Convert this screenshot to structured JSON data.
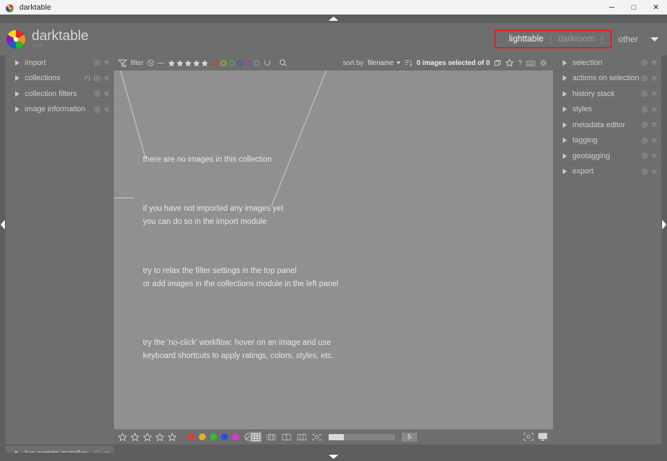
{
  "window": {
    "title": "darktable",
    "icon": "darktable-logo-icon",
    "buttons": {
      "minimize": "─",
      "maximize": "□",
      "close": "✕"
    }
  },
  "banner": {
    "logo_icon": "darktable-aperture-logo-icon",
    "brand": "darktable",
    "version": "4.0.0",
    "views": {
      "highlight_color": "#e02020",
      "items": [
        {
          "label": "lighttable",
          "active": true
        },
        {
          "label": "darkroom",
          "active": false
        },
        {
          "label": "other",
          "active": false
        }
      ],
      "separator": "|",
      "dropdown_icon": "chevron-down-icon"
    }
  },
  "left_panel": {
    "modules": [
      {
        "label": "import",
        "extra_icon": null
      },
      {
        "label": "collections",
        "extra_icon": "sort-icon"
      },
      {
        "label": "collection filters",
        "extra_icon": null
      },
      {
        "label": "image information",
        "extra_icon": null
      }
    ],
    "footer": {
      "label": "lua scripts installer"
    },
    "row_icons": [
      "reset-icon",
      "presets-icon"
    ]
  },
  "right_panel": {
    "modules": [
      {
        "label": "selection"
      },
      {
        "label": "actions on selection"
      },
      {
        "label": "history stack"
      },
      {
        "label": "styles"
      },
      {
        "label": "metadata editor"
      },
      {
        "label": "tagging"
      },
      {
        "label": "geotagging"
      },
      {
        "label": "export"
      }
    ],
    "row_icons": [
      "reset-icon",
      "presets-icon"
    ]
  },
  "filterbar": {
    "filter_icon": "filter-funnel-icon",
    "filter_label": "filter",
    "rating_reject_icon": "reject-circle-icon",
    "rating_dash": "—",
    "stars": 5,
    "color_labels": [
      "#b04a4a",
      "#b09a3a",
      "#4aa04a",
      "#4a5ab0",
      "#9a4aa8",
      "#8a8a8a"
    ],
    "grouping_icon": "grouping-icon",
    "search_icon": "search-icon",
    "sort_label": "sort by",
    "sort_value": "filename",
    "sort_direction_icon": "sort-ascending-icon",
    "selection_text": "0 images selected of 0",
    "right_icons": [
      "copy-icon",
      "star-icon",
      "help-icon",
      "shortcuts-icon",
      "preferences-gear-icon"
    ]
  },
  "canvas": {
    "messages": [
      "there are no images in this collection",
      "if you have not imported any images yet\nyou can do so in the import module",
      "try to relax the filter settings in the top panel\nor add images in the collections module in the left panel",
      "try the 'no-click' workflow: hover on an image and use\nkeyboard shortcuts to apply ratings, colors, styles, etc."
    ]
  },
  "bottombar": {
    "stars": 5,
    "color_dots": [
      "#e03b3b",
      "#e0b02a",
      "#2fc22f",
      "#2b4fe0",
      "#d83ad8"
    ],
    "reject_icon": "reject-circle-icon",
    "view_modes": [
      {
        "icon": "filemanager-grid-icon",
        "active": true
      },
      {
        "icon": "zoomable-lighttable-icon",
        "active": false
      },
      {
        "icon": "culling-fixed-icon",
        "active": false
      },
      {
        "icon": "culling-dynamic-icon",
        "active": false
      },
      {
        "icon": "full-preview-icon",
        "active": false
      }
    ],
    "zoom_value": "5",
    "right_icons": [
      "focus-detection-icon",
      "display-profile-icon"
    ]
  },
  "collapse": {
    "top_icon": "collapse-top-icon",
    "bottom_icon": "collapse-bottom-icon",
    "left_icon": "collapse-left-icon",
    "right_icon": "collapse-right-icon"
  }
}
